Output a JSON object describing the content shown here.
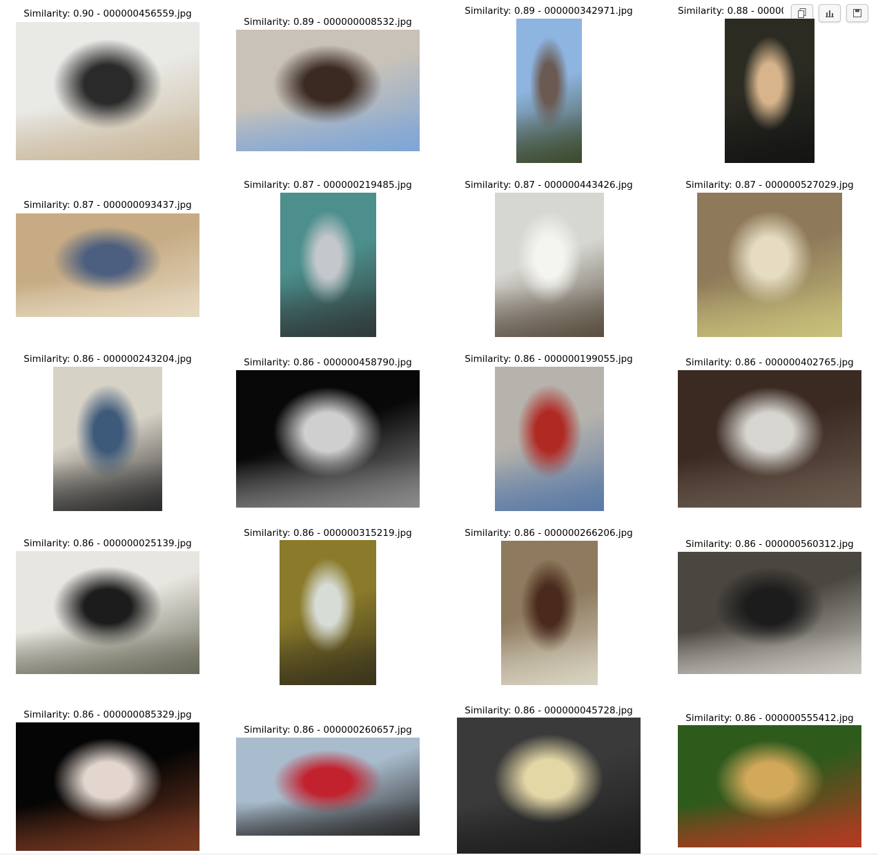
{
  "toolbar": {
    "copy_icon": "copy-icon",
    "chart_icon": "bar-chart-icon",
    "save_icon": "save-icon"
  },
  "results": [
    {
      "caption": "Similarity: 0.90 - 000000456559.jpg",
      "colors": [
        "#e9e9e6",
        "#2a2a2a",
        "#c9b79a"
      ]
    },
    {
      "caption": "Similarity: 0.89 - 000000008532.jpg",
      "colors": [
        "#c9c2b8",
        "#3a2a22",
        "#7fa6d6"
      ]
    },
    {
      "caption": "Similarity: 0.89 - 000000342971.jpg",
      "colors": [
        "#8eb4e0",
        "#6b5a52",
        "#3d4a2c"
      ]
    },
    {
      "caption": "Similarity: 0.88 - 000000",
      "colors": [
        "#2b2b22",
        "#d7b48c",
        "#141414"
      ]
    },
    {
      "caption": "Similarity: 0.87 - 000000093437.jpg",
      "colors": [
        "#c6ab84",
        "#4c5f80",
        "#e6d9c0"
      ]
    },
    {
      "caption": "Similarity: 0.87 - 000000219485.jpg",
      "colors": [
        "#4c8f8c",
        "#c4c8cc",
        "#303a3a"
      ]
    },
    {
      "caption": "Similarity: 0.87 - 000000443426.jpg",
      "colors": [
        "#d7d7d2",
        "#f4f4f0",
        "#5a4e40"
      ]
    },
    {
      "caption": "Similarity: 0.87 - 000000527029.jpg",
      "colors": [
        "#8e7a5a",
        "#e6dcc2",
        "#c9c07a"
      ]
    },
    {
      "caption": "Similarity: 0.86 - 000000243204.jpg",
      "colors": [
        "#d7d2c6",
        "#3e5a7a",
        "#2a2a2a"
      ]
    },
    {
      "caption": "Similarity: 0.86 - 000000458790.jpg",
      "colors": [
        "#080808",
        "#cfcfcf",
        "#8a8a8a"
      ]
    },
    {
      "caption": "Similarity: 0.86 - 000000199055.jpg",
      "colors": [
        "#b6b3ac",
        "#b02a24",
        "#5a7aa6"
      ]
    },
    {
      "caption": "Similarity: 0.86 - 000000402765.jpg",
      "colors": [
        "#3a2a22",
        "#d7d5d0",
        "#6a5a4e"
      ]
    },
    {
      "caption": "Similarity: 0.86 - 000000025139.jpg",
      "colors": [
        "#e8e6e0",
        "#1c1c1c",
        "#6a6a5a"
      ]
    },
    {
      "caption": "Similarity: 0.86 - 000000315219.jpg",
      "colors": [
        "#8a7a2a",
        "#d7dcd6",
        "#3a341c"
      ]
    },
    {
      "caption": "Similarity: 0.86 - 000000266206.jpg",
      "colors": [
        "#8e7a5e",
        "#4a2a1c",
        "#d7d2c0"
      ]
    },
    {
      "caption": "Similarity: 0.86 - 000000560312.jpg",
      "colors": [
        "#4a4640",
        "#1c1c1c",
        "#c9c6c0"
      ]
    },
    {
      "caption": "Similarity: 0.86 - 000000085329.jpg",
      "colors": [
        "#050505",
        "#e2d6ce",
        "#7a3a22"
      ]
    },
    {
      "caption": "Similarity: 0.86 - 000000260657.jpg",
      "colors": [
        "#a9bccd",
        "#c2222e",
        "#2a2a2a"
      ]
    },
    {
      "caption": "Similarity: 0.86 - 000000045728.jpg",
      "colors": [
        "#3a3a3a",
        "#e4d7a6",
        "#1c1c1c"
      ]
    },
    {
      "caption": "Similarity: 0.86 - 000000555412.jpg",
      "colors": [
        "#2e5a1c",
        "#d2a85a",
        "#b23a22"
      ]
    }
  ]
}
